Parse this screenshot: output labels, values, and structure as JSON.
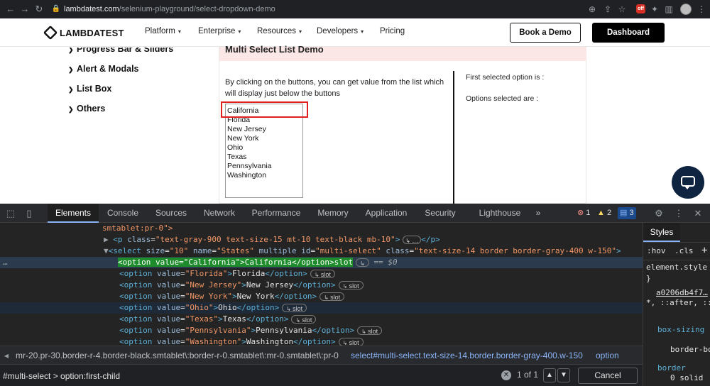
{
  "browser": {
    "url_host": "lambdatest.com",
    "url_path": "/selenium-playground/select-dropdown-demo",
    "ext_badge": "off"
  },
  "site": {
    "logo_text": "LAMBDATEST",
    "nav": [
      "Platform",
      "Enterprise",
      "Resources",
      "Developers",
      "Pricing"
    ],
    "book_demo": "Book a Demo",
    "dashboard": "Dashboard"
  },
  "sidebar": {
    "items": [
      "Progress Bar & Sliders",
      "Alert & Modals",
      "List Box",
      "Others"
    ]
  },
  "demo": {
    "title": "Multi Select List Demo",
    "description": "By clicking on the buttons, you can get value from the list which will display just below the buttons",
    "options": [
      "California",
      "Florida",
      "New Jersey",
      "New York",
      "Ohio",
      "Texas",
      "Pennsylvania",
      "Washington"
    ],
    "first_selected_label": "First selected option is :",
    "options_selected_label": "Options selected are :"
  },
  "devtools": {
    "tabs": [
      "Elements",
      "Console",
      "Sources",
      "Network",
      "Performance",
      "Memory",
      "Application",
      "Security",
      "Lighthouse"
    ],
    "more_tabs": "»",
    "errors": "1",
    "warnings": "2",
    "messages": "3",
    "dom": {
      "line0": "smtablet:pr-0\">",
      "line1_tag_open": "<p",
      "line1_attr": "class",
      "line1_val": "\"text-gray-900 text-size-15 mt-10 text-black mb-10\"",
      "line1_close": ">",
      "line1_ellipsis": "…",
      "line1_end": "</p>",
      "select_tag": "<select",
      "select_attrs": [
        {
          "n": "size",
          "v": "\"10\""
        },
        {
          "n": "name",
          "v": "\"States\""
        },
        {
          "n": "multiple",
          "v": ""
        },
        {
          "n": "id",
          "v": "\"multi-select\""
        },
        {
          "n": "class",
          "v": "\"text-size-14 border border-gray-400 w-150\""
        }
      ],
      "selected_line": "<option value=\"California\">California</option>",
      "selected_suffix": "== $0",
      "option_rows": [
        {
          "value": "\"Florida\"",
          "text": "Florida"
        },
        {
          "value": "\"New Jersey\"",
          "text": "New Jersey"
        },
        {
          "value": "\"New York\"",
          "text": "New York"
        },
        {
          "value": "\"Ohio\"",
          "text": "Ohio"
        },
        {
          "value": "\"Texas\"",
          "text": "Texas"
        },
        {
          "value": "\"Pennsylvania\"",
          "text": "Pennsylvania"
        },
        {
          "value": "\"Washington\"",
          "text": "Washington"
        }
      ],
      "slot_label": "slot"
    },
    "breadcrumb_left": "mr-20.pr-30.border-r-4.border-black.smtablet\\:border-r-0.smtablet\\:mr-0.smtablet\\:pr-0",
    "breadcrumb_select": "select#multi-select.text-size-14.border.border-gray-400.w-150",
    "breadcrumb_option": "option",
    "search_value": "#multi-select > option:first-child",
    "match_count": "1 of 1",
    "cancel": "Cancel",
    "styles": {
      "tab": "Styles",
      "hov": ":hov",
      "cls": ".cls",
      "element_style": "element.style {",
      "close_brace": "}",
      "source": "a0206db4f7…",
      "selector": "*, ::after, ::before {",
      "prop1": "box-sizing",
      "val1": "border-box;",
      "prop2": "border",
      "val2": "0 solid"
    }
  }
}
